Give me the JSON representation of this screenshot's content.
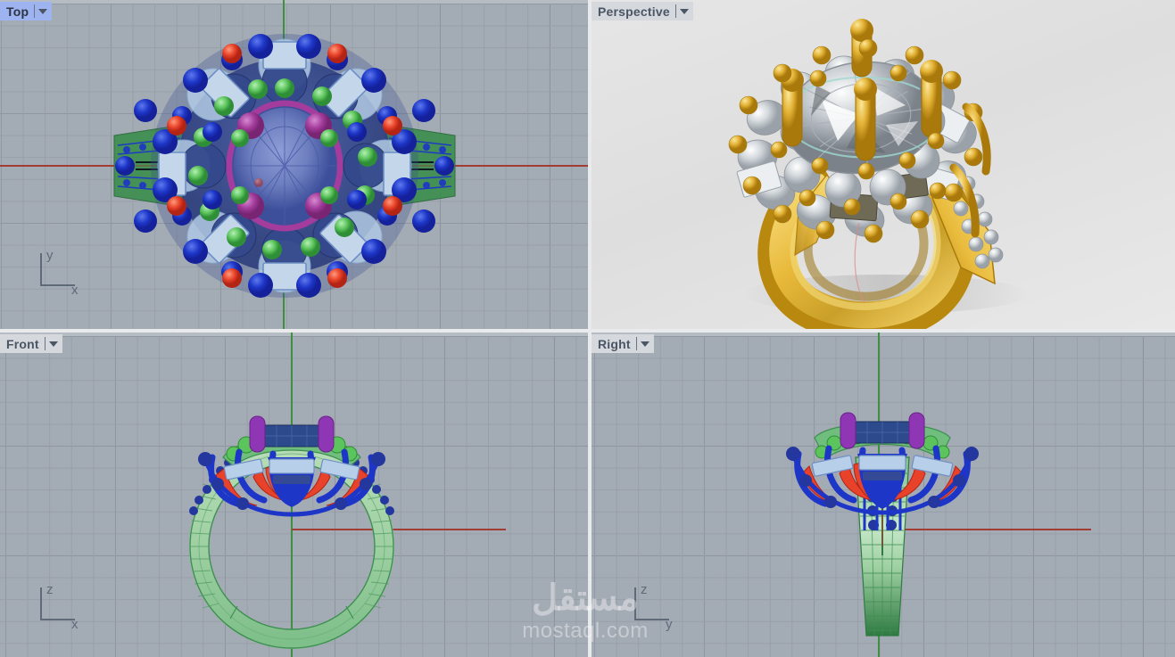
{
  "app": {
    "kind": "cad-4-viewport-layout",
    "viewport_count": 4
  },
  "viewports": [
    {
      "id": "top",
      "label": "Top",
      "state": "active",
      "shading": "wireframe",
      "background": "#a3abb5",
      "grid": true,
      "axis_indicator": {
        "vertical": "y",
        "horizontal": "x"
      },
      "axis_lines": {
        "vertical_color": "#3f8f41",
        "horizontal_color": "#a23c34"
      },
      "model": "ring-top-view"
    },
    {
      "id": "perspective",
      "label": "Perspective",
      "state": "inactive",
      "shading": "rendered",
      "background": "#e3e3e3",
      "grid": false,
      "axis_indicator": null,
      "model": "ring-rendered-gold-diamond"
    },
    {
      "id": "front",
      "label": "Front",
      "state": "inactive",
      "shading": "wireframe",
      "background": "#a3abb5",
      "grid": true,
      "axis_indicator": {
        "vertical": "z",
        "horizontal": "x"
      },
      "axis_lines": {
        "vertical_color": "#3f8f41",
        "horizontal_color": "#a23c34"
      },
      "model": "ring-front-view"
    },
    {
      "id": "right",
      "label": "Right",
      "state": "inactive",
      "shading": "wireframe",
      "background": "#a3abb5",
      "grid": true,
      "axis_indicator": {
        "vertical": "z",
        "horizontal": "y"
      },
      "axis_lines": {
        "vertical_color": "#3f8f41",
        "horizontal_color": "#a23c34"
      },
      "model": "ring-right-view"
    }
  ],
  "watermark": {
    "arabic": "مستقل",
    "latin": "mostaql.com"
  },
  "palette": {
    "viewport_bg": "#a3abb5",
    "perspective_bg": "#e3e3e3",
    "active_tab_bg": "#9db4f0",
    "inactive_tab_bg": "#d5d8dd",
    "tab_text": "#4b5665",
    "grid_minor": "#969da6",
    "grid_major": "#6e7682",
    "x_axis": "#a23c34",
    "y_axis": "#3f8f41",
    "divider": "#e9eaec",
    "gold": "#e8b93a",
    "gold_dark": "#b8860b",
    "diamond": "#d8dce0",
    "layer_blue": "#1d36c8",
    "layer_lightblue": "#a9c6e8",
    "layer_green": "#5cc45c",
    "layer_band_green": "#3f8f52",
    "layer_red": "#e8432a",
    "layer_purple": "#8e36b4",
    "layer_magenta": "#b43ca8",
    "layer_navy": "#2c4a8c"
  }
}
